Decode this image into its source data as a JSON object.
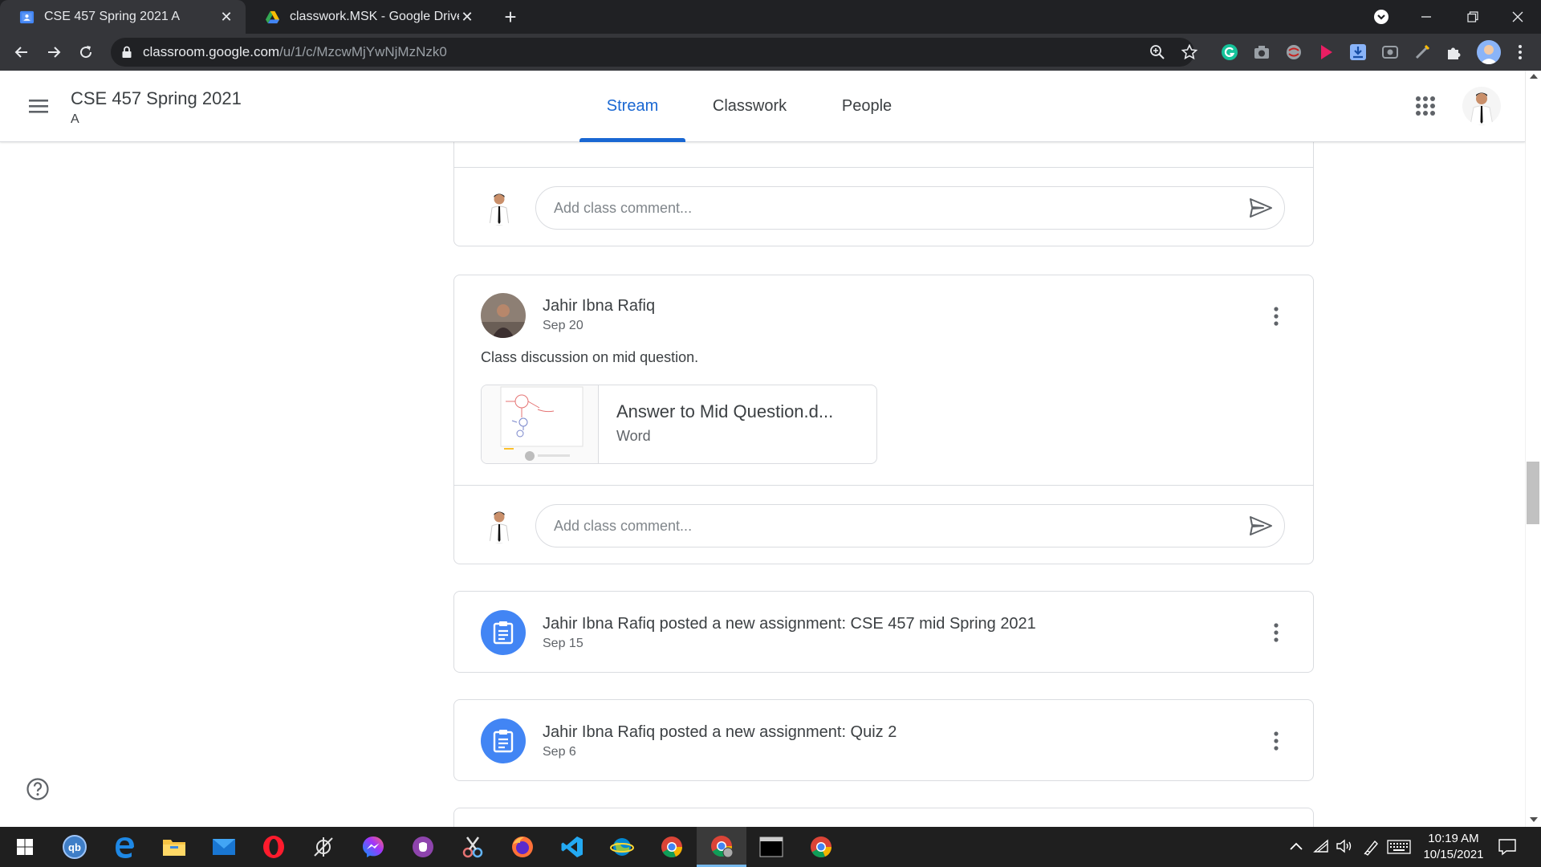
{
  "browser": {
    "tabs": [
      {
        "title": "CSE 457 Spring 2021 A",
        "active": true,
        "favicon": "google-classroom-icon"
      },
      {
        "title": "classwork.MSK - Google Drive",
        "active": false,
        "favicon": "google-drive-icon"
      }
    ],
    "url_host": "classroom.google.com",
    "url_path": "/u/1/c/MzcwMjYwNjMzNzk0"
  },
  "header": {
    "class_title": "CSE 457 Spring 2021",
    "class_section": "A",
    "tabs": [
      {
        "label": "Stream",
        "active": true
      },
      {
        "label": "Classwork",
        "active": false
      },
      {
        "label": "People",
        "active": false
      }
    ]
  },
  "stream": {
    "comment_placeholder": "Add class comment...",
    "post": {
      "author": "Jahir Ibna Rafiq",
      "date": "Sep 20",
      "text": "Class discussion on mid question.",
      "attachment": {
        "title": "Answer to Mid Question.d...",
        "type": "Word"
      }
    },
    "assignments": [
      {
        "text": "Jahir Ibna Rafiq posted a new assignment: CSE 457 mid Spring 2021",
        "date": "Sep 15"
      },
      {
        "text": "Jahir Ibna Rafiq posted a new assignment: Quiz 2",
        "date": "Sep 6"
      }
    ]
  },
  "taskbar": {
    "time": "10:19 AM",
    "date": "10/15/2021"
  },
  "colors": {
    "accent": "#1967d2",
    "assignment_icon": "#4285f4",
    "chrome_dark": "#202124"
  }
}
